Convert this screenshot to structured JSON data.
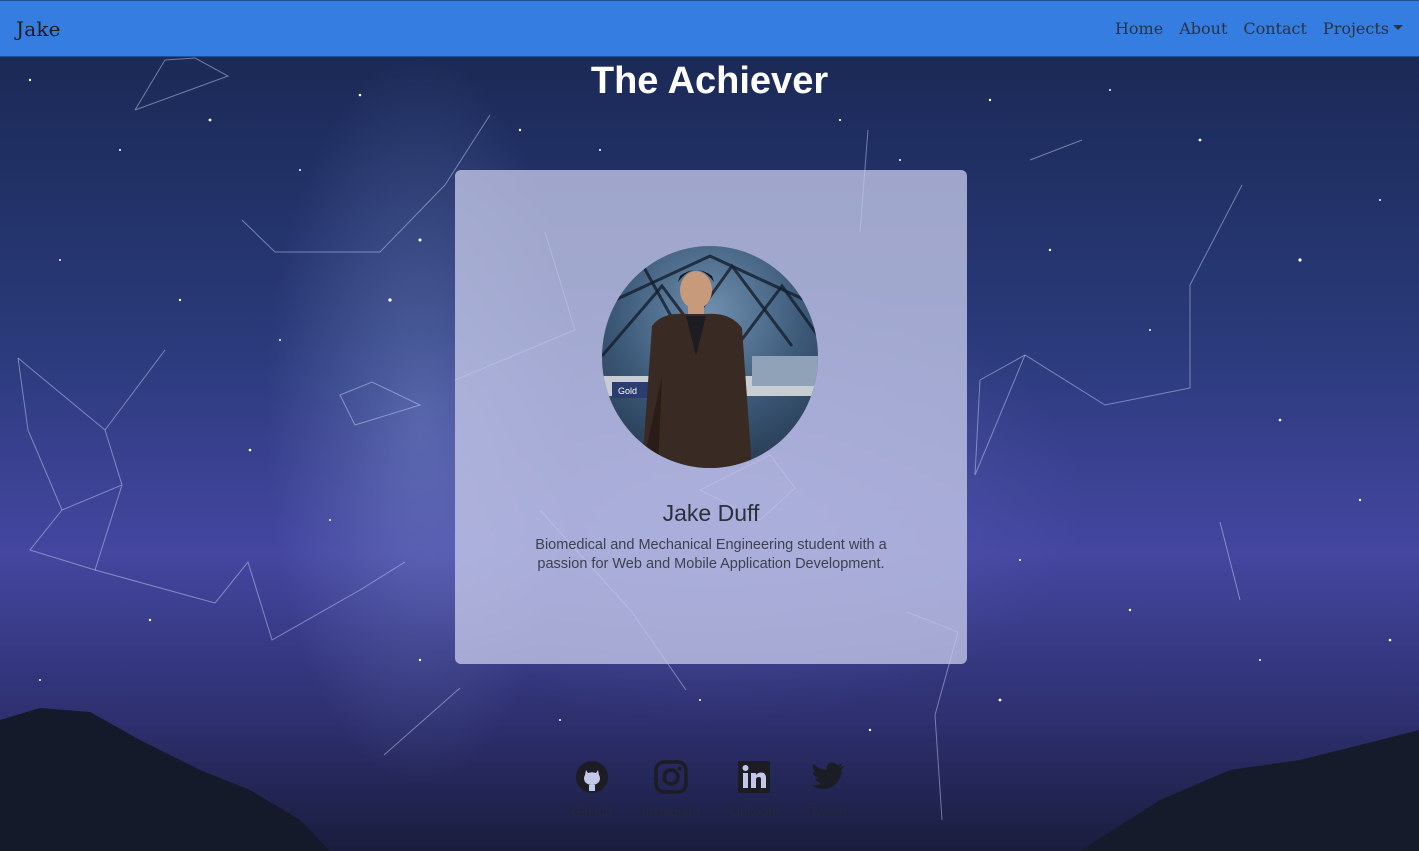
{
  "navbar": {
    "brand": "Jake",
    "links": [
      "Home",
      "About",
      "Contact",
      "Projects"
    ]
  },
  "page_title": "The Achiever",
  "profile": {
    "name": "Jake Duff",
    "bio": "Biomedical and Mechanical Engineering student with a passion for Web and Mobile Application Development.",
    "photo_caption": "Gold"
  },
  "social": [
    {
      "label": "GitHub",
      "icon": "github-icon"
    },
    {
      "label": "Instagram",
      "icon": "instagram-icon"
    },
    {
      "label": "LinkedIn",
      "icon": "linkedin-icon"
    },
    {
      "label": "Twitter",
      "icon": "twitter-icon"
    }
  ],
  "colors": {
    "navbar": "#357de0",
    "title": "#ffffff",
    "card": "#c4c8e8"
  }
}
